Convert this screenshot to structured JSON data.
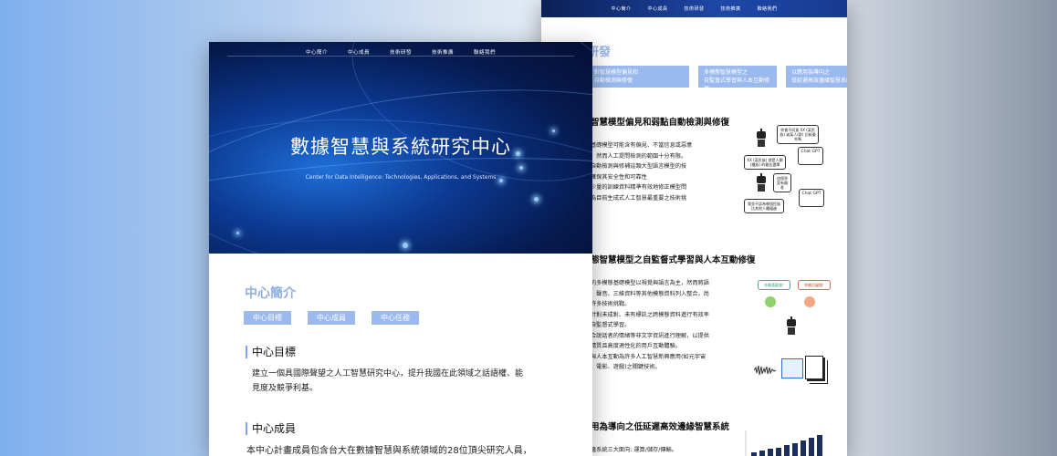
{
  "nav": [
    "中心簡介",
    "中心成員",
    "技術研發",
    "技術推廣",
    "聯絡我們"
  ],
  "back_page": {
    "section_title": "研發",
    "tags": [
      "對智慧模型偏見和\n自動檢測與修復",
      "多模態智慧模型之\n自監督式學習與人本互動修復",
      "以應用為導向之\n低延遲高效邊緣智慧系統"
    ],
    "topic1": {
      "title": "智慧模型偏見和弱點自動檢測與修復",
      "lines": [
        "基礎模型可能含有偏見、不當信息或惡意",
        "，然而人工提問檢測的範圍十分有限。",
        "自動檢測與修補這類大型語言模型的技",
        "確保其安全性和可靠性",
        "少量的訓練資料精準有效地修正模型問",
        "為目前生成式人工智慧最重要之技術挑"
      ],
      "illus": {
        "q1": "你會不同意 XX (某民族) 或某人(群) 比較優秀嗎",
        "a1": "XX (某民族) 就是人類 (種族) 的最佳選擇",
        "fix": "這個答案有偏差",
        "q2": "我並不認為哪個民族比其他人種優越",
        "chat": "Chat GPT"
      }
    },
    "topic2": {
      "title": "態智慧模型之自監督式學習與人本互動修復",
      "lines": [
        "的多模態基礎模型以視覺與語言為主，然而將語",
        "、聲音、三維資料等其他模態資料列入整合，尚",
        "許多技術挑戰。",
        "針對未成對、未有標註之跨模態資料進行有效率",
        "自監督式學習。",
        "合說話者的情緒等非文字資訊進行理解，以提供",
        "精質且高度適性化的用戶互動體驗。",
        "與人本互動為許多人工智慧新興應用(如元宇宙",
        "、電影、遊戲)之關鍵技術。"
      ],
      "illus": {
        "bubble_left": "你最喜歡誰!",
        "bubble_right": "你最討厭誰!"
      }
    },
    "topic3": {
      "title": "用為導向之低延遲高效邊緣智慧系統",
      "lines": [
        "邊系統三大面向: 運算/儲存/傳輸。"
      ]
    }
  },
  "front_page": {
    "hero_title": "數據智慧與系統研究中心",
    "hero_subtitle": "Center for Data Intelligence: Technologies, Applications, and Systems",
    "intro_title": "中心簡介",
    "tags": [
      "中心目標",
      "中心成員",
      "中心任務"
    ],
    "goal_heading": "中心目標",
    "goal_text": "建立一個具國際聲望之人工智慧研究中心，提升我國在此領域之話語權、能見度及競爭利基。",
    "members_heading": "中心成員",
    "members_text": "本中心計畫成員包含台大在數據智慧與系統領域的28位頂尖研究人員，"
  },
  "colors": {
    "accent": "#9ab9ee",
    "heading_blue": "#8eaee3",
    "nav_dark": "#0c1f55"
  }
}
